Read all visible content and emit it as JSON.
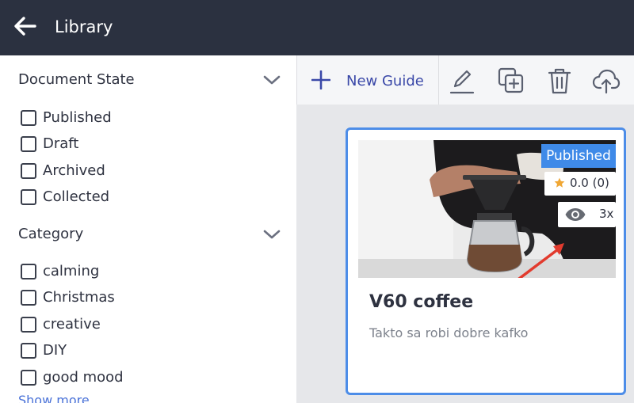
{
  "header": {
    "title": "Library",
    "back_icon": "arrow-left-icon",
    "background": "#2b3140"
  },
  "sidebar": {
    "document_state": {
      "title": "Document State",
      "options": [
        "Published",
        "Draft",
        "Archived",
        "Collected"
      ]
    },
    "category": {
      "title": "Category",
      "options": [
        "calming",
        "Christmas",
        "creative",
        "DIY",
        "good mood"
      ]
    },
    "show_more": "Show more"
  },
  "toolbar": {
    "new_guide_label": "New Guide",
    "icons": [
      "edit-icon",
      "duplicate-icon",
      "delete-icon",
      "upload-cloud-icon"
    ]
  },
  "card": {
    "title": "V60 coffee",
    "description": "Takto sa robi dobre kafko",
    "status_badge": "Published",
    "rating": "0.0 (0)",
    "views": "3x",
    "accent": "#4d8de8",
    "badge_color": "#3f8ae8"
  }
}
